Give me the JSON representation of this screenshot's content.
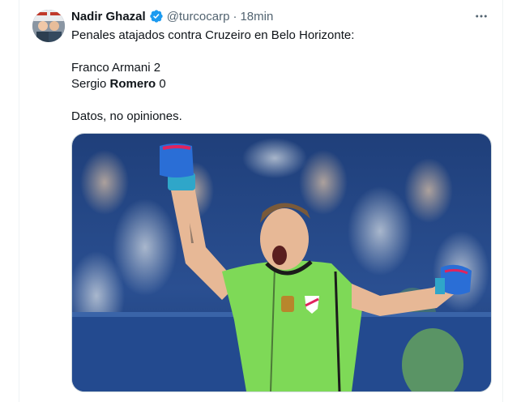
{
  "tweet": {
    "author_name": "Nadir Ghazal",
    "handle": "@turcocarp",
    "separator": "·",
    "time": "18min",
    "lines": {
      "l1": "Penales atajados contra Cruzeiro en Belo Horizonte:",
      "l2": "Franco Armani 2",
      "l3_prefix": "Sergio ",
      "l3_bold": "Romero",
      "l3_suffix": " 0",
      "l4": "Datos, no opiniones."
    }
  },
  "icons": {
    "verified": "verified-badge-icon",
    "more": "more-horizontal-icon"
  },
  "colors": {
    "accent": "#1d9bf0",
    "text": "#0f1419",
    "secondary": "#536471",
    "border": "#cfd9de",
    "jersey": "#7ed957"
  }
}
